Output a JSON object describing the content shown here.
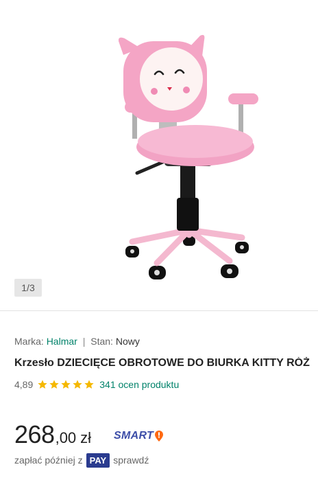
{
  "gallery": {
    "image": "pink kitty swivel desk chair",
    "counter": "1/3"
  },
  "product": {
    "brand_label": "Marka:",
    "brand_value": "Halmar",
    "separator": "|",
    "condition_label": "Stan:",
    "condition_value": "Nowy",
    "title": "Krzesło DZIECIĘCE OBROTOWE DO BIURKA KITTY RÓŻ",
    "rating_value": "4,89",
    "stars": 5,
    "rating_count": "341 ocen produktu"
  },
  "price": {
    "integer": "268",
    "decimal": ",00",
    "currency": "zł",
    "smart_label": "SMART"
  },
  "pay_later": {
    "prefix": "zapłać później z",
    "badge": "PAY",
    "suffix": "sprawdź"
  },
  "colors": {
    "accent_green": "#00826a",
    "star": "#f5b800",
    "smart_blue": "#3d4ea8",
    "smart_orange": "#ff6a13",
    "pay_blue": "#2a3b8f"
  }
}
